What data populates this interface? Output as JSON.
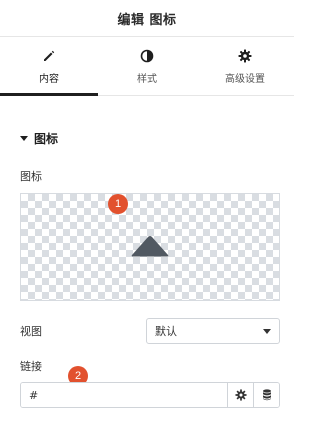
{
  "header": {
    "title": "编辑 图标"
  },
  "tabs": [
    {
      "label": "内容",
      "icon": "pencil-icon",
      "active": true
    },
    {
      "label": "样式",
      "icon": "contrast-icon",
      "active": false
    },
    {
      "label": "高级设置",
      "icon": "gear-icon",
      "active": false
    }
  ],
  "section": {
    "title": "图标"
  },
  "icon_field": {
    "label": "图标",
    "preview_icon": "caret-up-icon"
  },
  "view_field": {
    "label": "视图",
    "selected": "默认"
  },
  "link_field": {
    "label": "链接",
    "value": "#"
  },
  "markers": [
    "1",
    "2"
  ],
  "colors": {
    "marker": "#e2512e",
    "icon": "#515962",
    "active_tab_underline": "#1f1f1f"
  }
}
